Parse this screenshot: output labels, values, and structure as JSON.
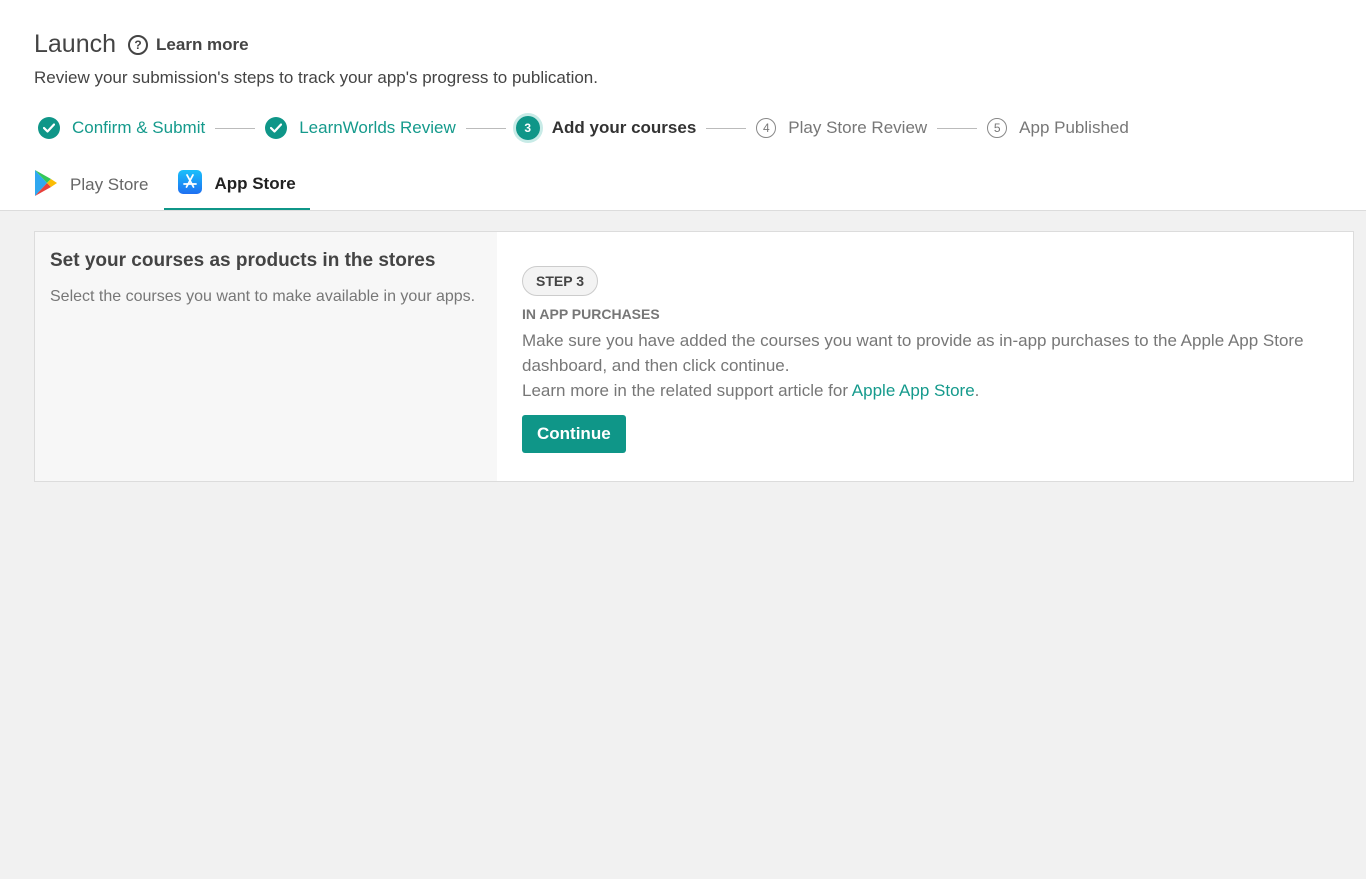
{
  "header": {
    "title": "Launch",
    "learn_more": "Learn more",
    "subtitle": "Review your submission's steps to track your app's progress to publication."
  },
  "stepper": {
    "steps": [
      {
        "number": "1",
        "label": "Confirm & Submit",
        "state": "done"
      },
      {
        "number": "2",
        "label": "LearnWorlds Review",
        "state": "done"
      },
      {
        "number": "3",
        "label": "Add your courses",
        "state": "current"
      },
      {
        "number": "4",
        "label": "Play Store Review",
        "state": "pending"
      },
      {
        "number": "5",
        "label": "App Published",
        "state": "pending"
      }
    ]
  },
  "tabs": [
    {
      "label": "Play Store",
      "icon": "play-store-icon",
      "active": false
    },
    {
      "label": "App Store",
      "icon": "app-store-icon",
      "active": true
    }
  ],
  "card": {
    "left": {
      "title": "Set your courses as products in the stores",
      "description": "Select the courses you want to make available in your apps."
    },
    "right": {
      "step_badge": "STEP 3",
      "section_label": "IN APP PURCHASES",
      "body": "Make sure you have added the courses you want to provide as in-app purchases to the Apple App Store dashboard, and then click continue.",
      "support_prefix": "Learn more in the related support article for ",
      "support_link": "Apple App Store",
      "support_suffix": ".",
      "continue_label": "Continue"
    }
  },
  "colors": {
    "accent": "#0f9688",
    "page_background": "#f1f1f1"
  }
}
